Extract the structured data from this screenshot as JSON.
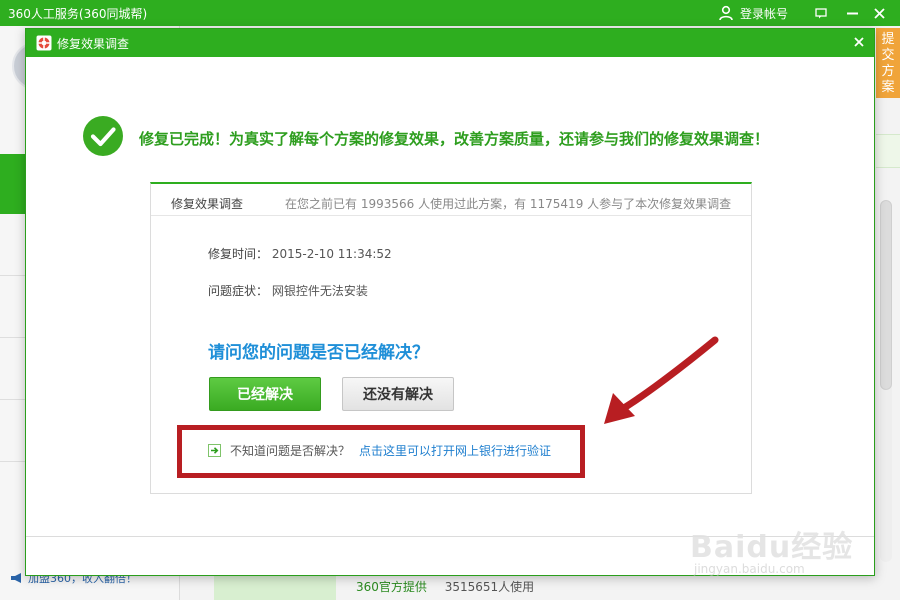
{
  "app": {
    "title": "360人工服务(360同城帮)",
    "login_label": "登录帐号",
    "submit_tab": "提交方案",
    "join_text": "加盟360，收入翻倍！",
    "bottom_official": "360官方提供",
    "bottom_usage": "3515651人使用"
  },
  "dialog": {
    "title": "修复效果调查",
    "success_message": "修复已完成！为真实了解每个方案的修复效果，改善方案质量，还请参与我们的修复效果调查！"
  },
  "survey": {
    "card_title": "修复效果调查",
    "stats_text": "在您之前已有 1993566 人使用过此方案，有 1175419 人参与了本次修复效果调查",
    "repair_time_label": "修复时间：",
    "repair_time_value": "2015-2-10 11:34:52",
    "symptom_label": "问题症状：",
    "symptom_value": "网银控件无法安装",
    "question": "请问您的问题是否已经解决？",
    "solved_button": "已经解决",
    "not_solved_button": "还没有解决",
    "hint_text": "不知道问题是否解决？",
    "hint_link": "点击这里可以打开网上银行进行验证"
  },
  "watermark": {
    "main": "Baidu经验",
    "sub": "jingyan.baidu.com"
  },
  "colors": {
    "brand_green": "#2eae1f",
    "question_blue": "#1f8fd8",
    "annotation_red": "#b81e22",
    "submit_orange": "#f0a43a"
  },
  "icons": [
    "user-icon",
    "message-icon",
    "minimize-icon",
    "close-icon",
    "lifebuoy-icon",
    "checkmark-icon",
    "arrow-right-icon",
    "megaphone-icon"
  ]
}
